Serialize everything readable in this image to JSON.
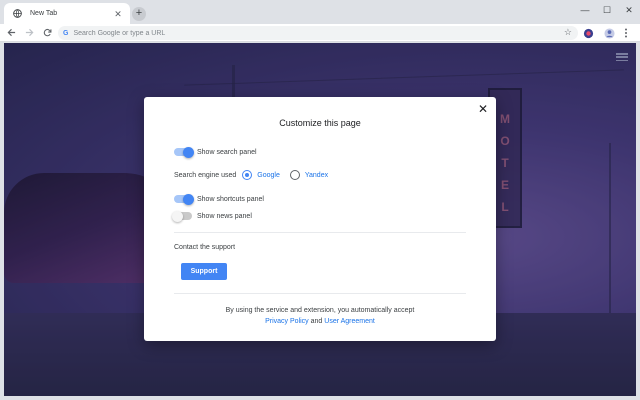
{
  "browser": {
    "tab": {
      "title": "New Tab",
      "favicon": "globe-icon",
      "close": "✕"
    },
    "new_tab": "+",
    "window_controls": [
      "—",
      "☐",
      "✕"
    ],
    "omnibox": {
      "placeholder": "Search Google or type a URL",
      "engine_letter": "G"
    }
  },
  "page": {
    "motel_sign": [
      "M",
      "O",
      "T",
      "E",
      "L"
    ]
  },
  "modal": {
    "title": "Customize this page",
    "close": "✕",
    "show_search_panel": {
      "label": "Show search panel",
      "enabled": true
    },
    "search_engine": {
      "label": "Search engine used",
      "options": [
        {
          "label": "Google",
          "selected": true
        },
        {
          "label": "Yandex",
          "selected": false
        }
      ]
    },
    "show_shortcuts_panel": {
      "label": "Show shortcuts panel",
      "enabled": true
    },
    "show_news_panel": {
      "label": "Show news panel",
      "enabled": false
    },
    "contact_label": "Contact the support",
    "support_button": "Support",
    "footer_text": "By using the service and extension, you automatically accept",
    "privacy_link": "Privacy Policy",
    "and_text": "and",
    "agreement_link": "User Agreement"
  },
  "colors": {
    "accent": "#4285f4",
    "link": "#1a73e8"
  }
}
